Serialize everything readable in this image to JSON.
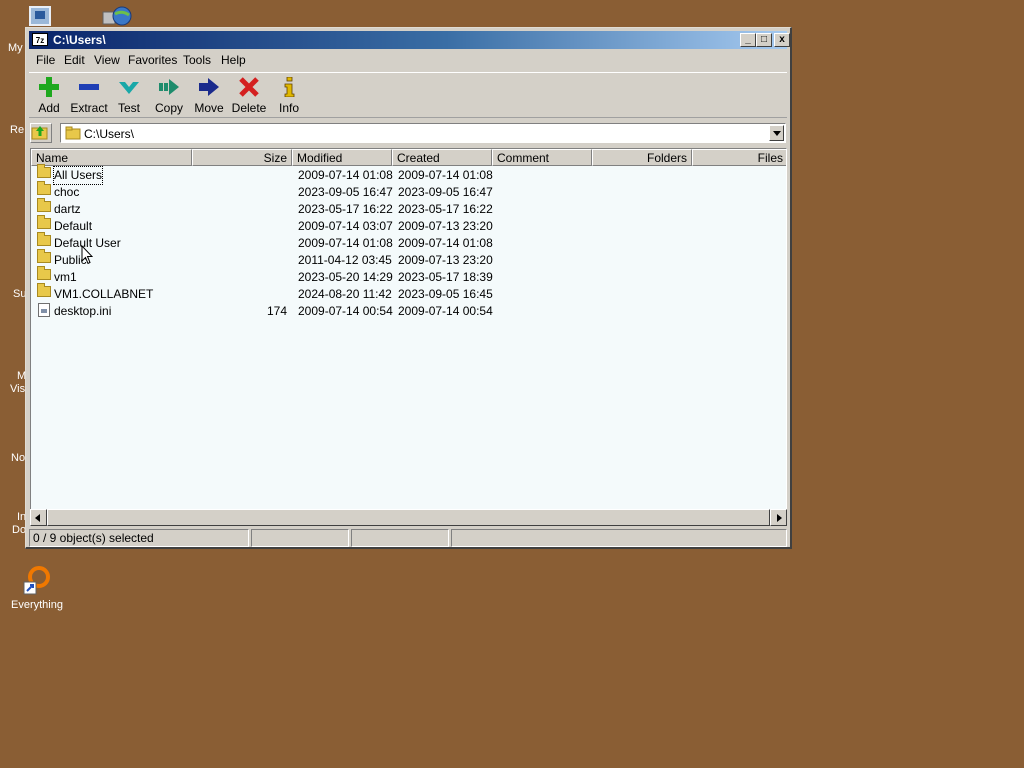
{
  "desktop": {
    "icons": [
      {
        "label": "My",
        "icon": "computer-icon"
      },
      {
        "label": "",
        "icon": "network-icon"
      },
      {
        "label": "Re",
        "icon": "recycle-bin-icon"
      },
      {
        "label": "Su",
        "icon": "shortcut-icon"
      },
      {
        "label": "M",
        "icon": "shortcut-icon"
      },
      {
        "label": "Vis",
        "icon": "shortcut-icon"
      },
      {
        "label": "No",
        "icon": "shortcut-icon"
      },
      {
        "label": "In",
        "icon": "shortcut-icon"
      },
      {
        "label": "Do",
        "icon": "shortcut-icon"
      },
      {
        "label": "Everything",
        "icon": "everything-search-icon"
      }
    ]
  },
  "window": {
    "title": "C:\\Users\\",
    "app_icon_text": "7z",
    "controls": {
      "minimize": "_",
      "maximize": "□",
      "close": "x"
    }
  },
  "menu": [
    "File",
    "Edit",
    "View",
    "Favorites",
    "Tools",
    "Help"
  ],
  "toolbar": [
    {
      "label": "Add",
      "icon": "plus-icon",
      "color": "#1ea81e"
    },
    {
      "label": "Extract",
      "icon": "minus-icon",
      "color": "#1f3fb5"
    },
    {
      "label": "Test",
      "icon": "check-icon",
      "color": "#19a8a8"
    },
    {
      "label": "Copy",
      "icon": "copy-arrow-icon",
      "color": "#1e8c6c"
    },
    {
      "label": "Move",
      "icon": "move-arrow-icon",
      "color": "#1a2a8c"
    },
    {
      "label": "Delete",
      "icon": "delete-x-icon",
      "color": "#d42020"
    },
    {
      "label": "Info",
      "icon": "info-icon",
      "color": "#e0b800"
    }
  ],
  "address": {
    "value": "C:\\Users\\"
  },
  "columns": [
    "Name",
    "Size",
    "Modified",
    "Created",
    "Comment",
    "Folders",
    "Files"
  ],
  "rows": [
    {
      "name": "All Users",
      "size": "",
      "modified": "2009-07-14 01:08",
      "created": "2009-07-14 01:08",
      "type": "folder"
    },
    {
      "name": "choc",
      "size": "",
      "modified": "2023-09-05 16:47",
      "created": "2023-09-05 16:47",
      "type": "folder"
    },
    {
      "name": "dartz",
      "size": "",
      "modified": "2023-05-17 16:22",
      "created": "2023-05-17 16:22",
      "type": "folder"
    },
    {
      "name": "Default",
      "size": "",
      "modified": "2009-07-14 03:07",
      "created": "2009-07-13 23:20",
      "type": "folder"
    },
    {
      "name": "Default User",
      "size": "",
      "modified": "2009-07-14 01:08",
      "created": "2009-07-14 01:08",
      "type": "folder"
    },
    {
      "name": "Public",
      "size": "",
      "modified": "2011-04-12 03:45",
      "created": "2009-07-13 23:20",
      "type": "folder"
    },
    {
      "name": "vm1",
      "size": "",
      "modified": "2023-05-20 14:29",
      "created": "2023-05-17 18:39",
      "type": "folder"
    },
    {
      "name": "VM1.COLLABNET",
      "size": "",
      "modified": "2024-08-20 11:42",
      "created": "2023-09-05 16:45",
      "type": "folder"
    },
    {
      "name": "desktop.ini",
      "size": "174",
      "modified": "2009-07-14 00:54",
      "created": "2009-07-14 00:54",
      "type": "file"
    }
  ],
  "status": {
    "selection": "0 / 9 object(s) selected"
  }
}
